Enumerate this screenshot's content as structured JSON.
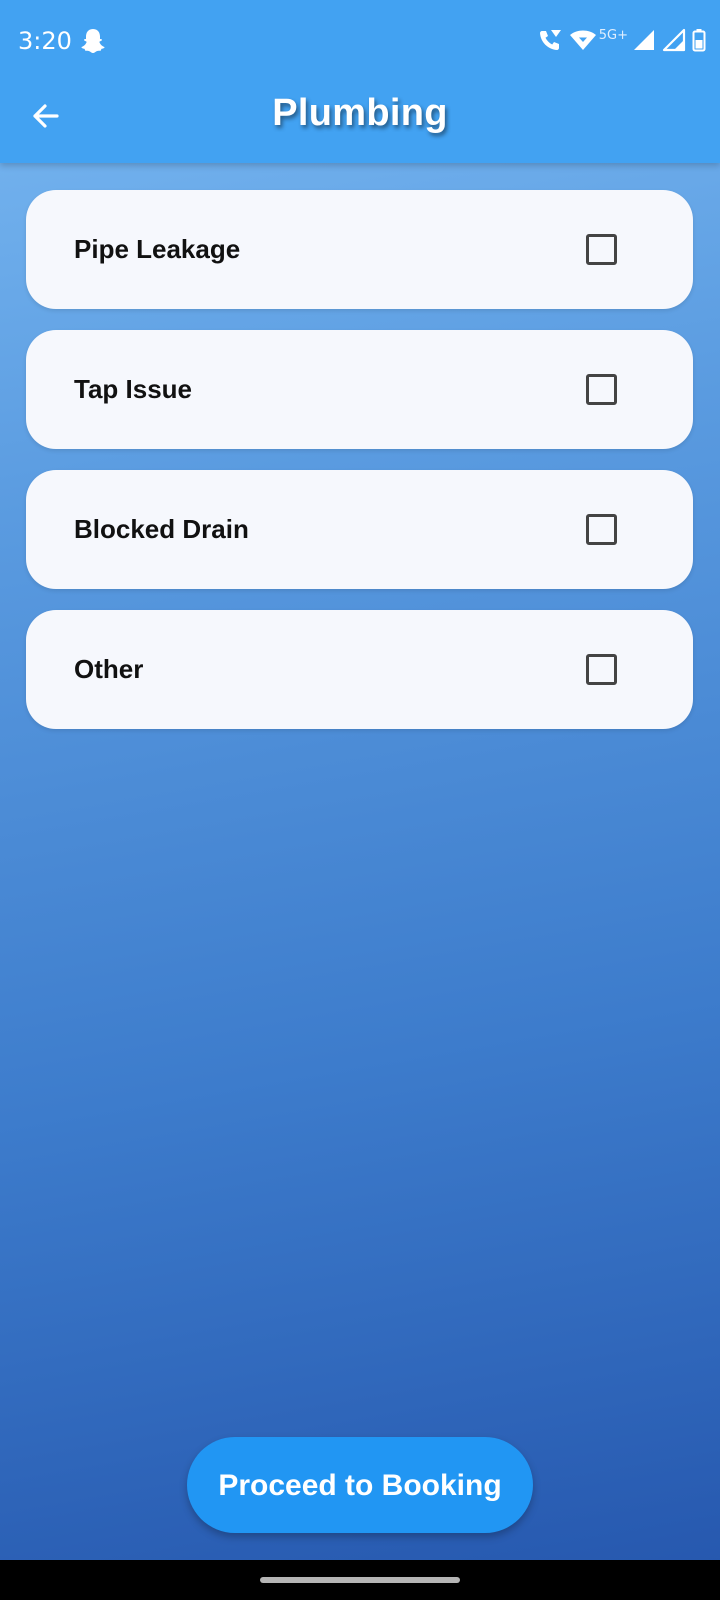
{
  "status_bar": {
    "time": "3:20",
    "network_label": "5G+",
    "icons": [
      "snapchat-icon",
      "wifi-calling-icon",
      "wifi-icon",
      "signal-icon",
      "signal-icon",
      "battery-icon"
    ]
  },
  "header": {
    "title": "Plumbing",
    "back_icon": "arrow-left-icon"
  },
  "options": [
    {
      "label": "Pipe Leakage",
      "checked": false
    },
    {
      "label": "Tap Issue",
      "checked": false
    },
    {
      "label": "Blocked Drain",
      "checked": false
    },
    {
      "label": "Other",
      "checked": false
    }
  ],
  "footer": {
    "proceed_label": "Proceed to Booking"
  },
  "colors": {
    "app_bar": "#42a2f2",
    "button": "#2196f3",
    "card": "#f6f8fd",
    "background_top": "#7bbaf3",
    "background_bottom": "#2556ad"
  }
}
